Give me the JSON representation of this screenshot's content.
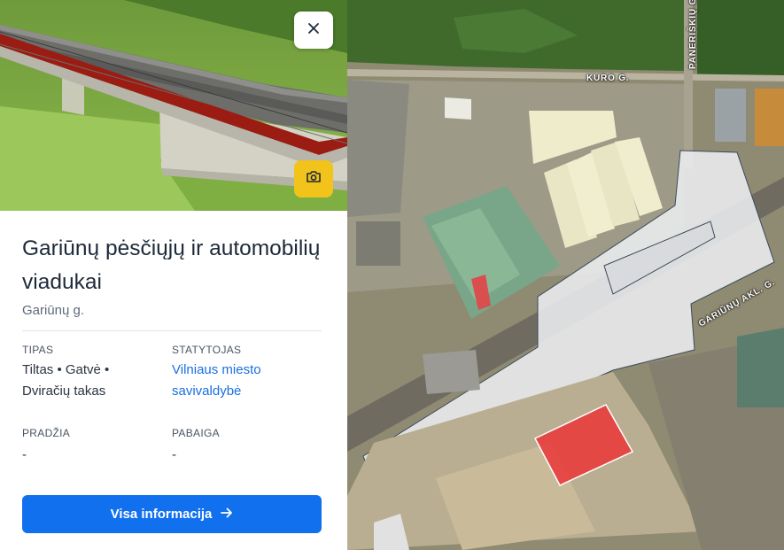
{
  "panel": {
    "close_icon": "close-icon",
    "camera_icon": "camera-icon",
    "title": "Gariūnų pėsčiųjų ir automobilių viadukai",
    "subtitle": "Gariūnų g.",
    "fields": {
      "type_label": "TIPAS",
      "type_value_line1": "Tiltas • Gatvė •",
      "type_value_line2": "Dviračių takas",
      "builder_label": "STATYTOJAS",
      "builder_value_line1": "Vilniaus miesto",
      "builder_value_line2": "savivaldybė",
      "start_label": "PRADŽIA",
      "start_value": "-",
      "end_label": "PABAIGA",
      "end_value": "-"
    },
    "cta_label": "Visa informacija",
    "cta_icon": "arrow-right-icon"
  },
  "map": {
    "streets": {
      "kuro": "KURO G.",
      "paneriskiu": "PANERIŠKIŲ G.",
      "gariunu": "GARIŪNŲ AKL. G."
    },
    "colors": {
      "accent": "#1070ee",
      "camera_button": "#f2c31b",
      "highlight_area": "#e83a3a"
    }
  }
}
